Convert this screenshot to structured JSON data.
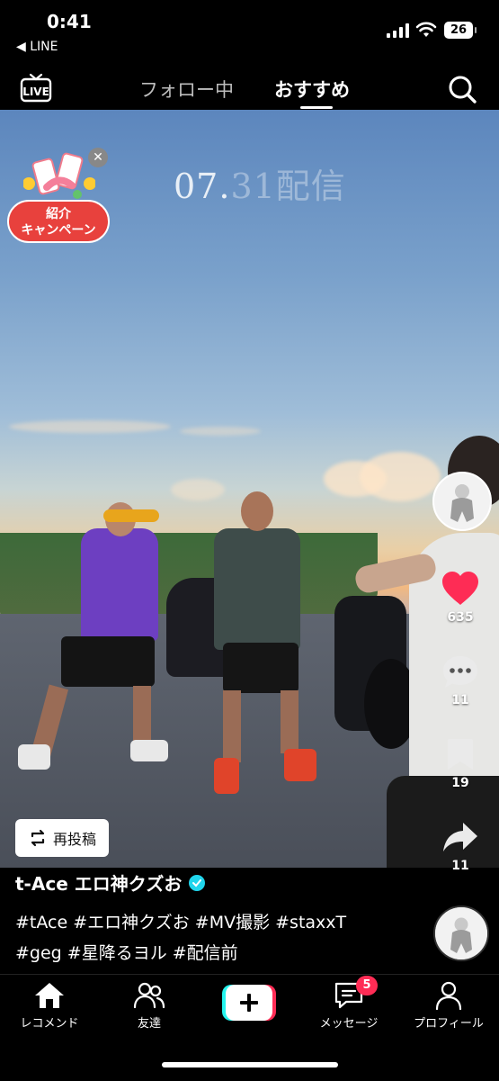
{
  "status_bar": {
    "time": "0:41",
    "back_app": "◀ LINE",
    "battery": "26"
  },
  "top_nav": {
    "tab_following": "フォロー中",
    "tab_recommended": "おすすめ"
  },
  "video": {
    "overlay_date": "07.",
    "overlay_date_faded": "31配信",
    "campaign_label": "紹介\nキャンペーン",
    "repost_label": "再投稿"
  },
  "actions": {
    "likes": "635",
    "comments": "11",
    "saves": "19",
    "shares": "11"
  },
  "caption": {
    "author": "t-Ace エロ神クズお",
    "line1": "#tAce #エロ神クズお #MV撮影 #staxxT",
    "line2": "#geg #星降るヨル #配信前"
  },
  "bottom_nav": {
    "home": "レコメンド",
    "friends": "友達",
    "messages": "メッセージ",
    "messages_badge": "5",
    "profile": "プロフィール"
  },
  "colors": {
    "like": "#fe2c55",
    "verified": "#20d5ec",
    "create_left": "#25f4ee",
    "create_right": "#fe2c55"
  }
}
